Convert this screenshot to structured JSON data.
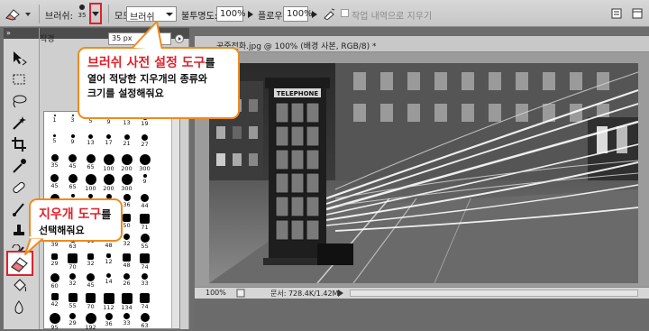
{
  "options_bar": {
    "brush_label": "브러쉬:",
    "brush_size": "35",
    "mode_label": "모드:",
    "mode_value": "브러쉬",
    "opacity_label": "불투명도:",
    "opacity_value": "100%",
    "flow_label": "플로우:",
    "flow_value": "100%",
    "history_label": "작업 내역으로 지우기"
  },
  "brush_panel": {
    "diameter_label": "직경",
    "diameter_value": "35 px",
    "presets": [
      {
        "size": "1"
      },
      {
        "size": "3"
      },
      {
        "size": "5"
      },
      {
        "size": "9"
      },
      {
        "size": "13"
      },
      {
        "size": "19"
      },
      {
        "size": ""
      },
      {
        "size": "5"
      },
      {
        "size": "9"
      },
      {
        "size": "13"
      },
      {
        "size": "17"
      },
      {
        "size": "21"
      },
      {
        "size": "27"
      },
      {
        "size": ""
      },
      {
        "size": "35"
      },
      {
        "size": "45"
      },
      {
        "size": "65"
      },
      {
        "size": "100"
      },
      {
        "size": "200"
      },
      {
        "size": "300"
      },
      {
        "size": ""
      },
      {
        "size": "45"
      },
      {
        "size": "65"
      },
      {
        "size": "100"
      },
      {
        "size": "200"
      },
      {
        "size": "300"
      },
      {
        "size": "9"
      },
      {
        "size": ""
      },
      {
        "size": "59"
      },
      {
        "size": "11"
      },
      {
        "size": "17"
      },
      {
        "size": "23"
      },
      {
        "size": "36"
      },
      {
        "size": "44"
      },
      {
        "size": ""
      },
      {
        "size": "25"
      },
      {
        "size": "50"
      },
      {
        "size": "71"
      },
      {
        "size": "25"
      },
      {
        "size": "50"
      },
      {
        "size": "71"
      },
      {
        "size": ""
      },
      {
        "size": "39"
      },
      {
        "size": "63"
      },
      {
        "size": "11"
      },
      {
        "size": "48"
      },
      {
        "size": "32"
      },
      {
        "size": "55"
      },
      {
        "size": ""
      },
      {
        "size": "29"
      },
      {
        "size": "70"
      },
      {
        "size": "32"
      },
      {
        "size": "12"
      },
      {
        "size": "48"
      },
      {
        "size": "74"
      },
      {
        "size": ""
      },
      {
        "size": "60"
      },
      {
        "size": "32"
      },
      {
        "size": "45"
      },
      {
        "size": "14"
      },
      {
        "size": "26"
      },
      {
        "size": "33"
      },
      {
        "size": ""
      },
      {
        "size": "42"
      },
      {
        "size": "55"
      },
      {
        "size": "70"
      },
      {
        "size": "112"
      },
      {
        "size": "134"
      },
      {
        "size": "74"
      },
      {
        "size": ""
      },
      {
        "size": "95"
      },
      {
        "size": "29"
      },
      {
        "size": "192"
      },
      {
        "size": "36"
      },
      {
        "size": "33"
      },
      {
        "size": "63"
      },
      {
        "size": ""
      }
    ]
  },
  "document": {
    "tab_title": "공중전화.jpg @ 100% (배경 사본, RGB/8) *",
    "zoom": "100%",
    "doc_info": "문서: 728.4K/1.42M",
    "booth_sign": "TELEPHONE"
  },
  "callouts": {
    "brush_preset": {
      "highlight": "브러쉬 사전 설정 도구",
      "suffix": "를",
      "line2": "열어 적당한 지우개의 종류와",
      "line3": "크기를 설정해줘요"
    },
    "eraser": {
      "highlight": "지우개 도구",
      "suffix": "를",
      "line2": "선택해줘요"
    }
  },
  "colors": {
    "highlight_red": "#e0202a",
    "callout_border": "#f08a1c"
  }
}
